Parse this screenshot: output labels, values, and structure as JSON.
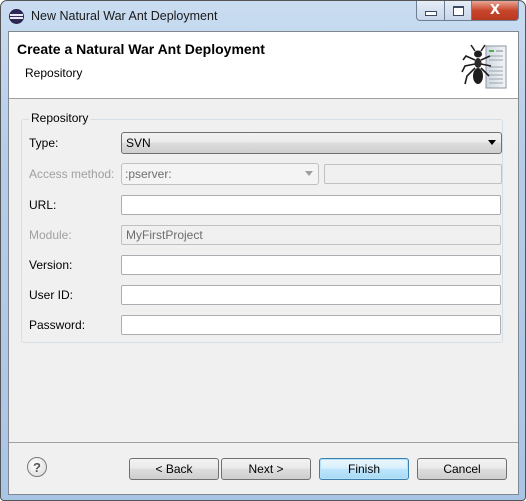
{
  "window": {
    "title": "New Natural War Ant Deployment",
    "controls": {
      "minimize": "minimize",
      "maximize": "maximize",
      "close": "X"
    }
  },
  "header": {
    "title": "Create a Natural War Ant Deployment",
    "subtitle": "Repository"
  },
  "form": {
    "group_label": "Repository",
    "type": {
      "label": "Type:",
      "value": "SVN"
    },
    "access_method": {
      "label": "Access method:",
      "value": ":pserver:",
      "extra_value": ""
    },
    "url": {
      "label": "URL:",
      "value": ""
    },
    "module": {
      "label": "Module:",
      "value": "MyFirstProject"
    },
    "version": {
      "label": "Version:",
      "value": ""
    },
    "user_id": {
      "label": "User ID:",
      "value": ""
    },
    "password": {
      "label": "Password:",
      "value": ""
    }
  },
  "footer": {
    "help_glyph": "?",
    "back": "< Back",
    "next": "Next >",
    "finish": "Finish",
    "cancel": "Cancel"
  }
}
